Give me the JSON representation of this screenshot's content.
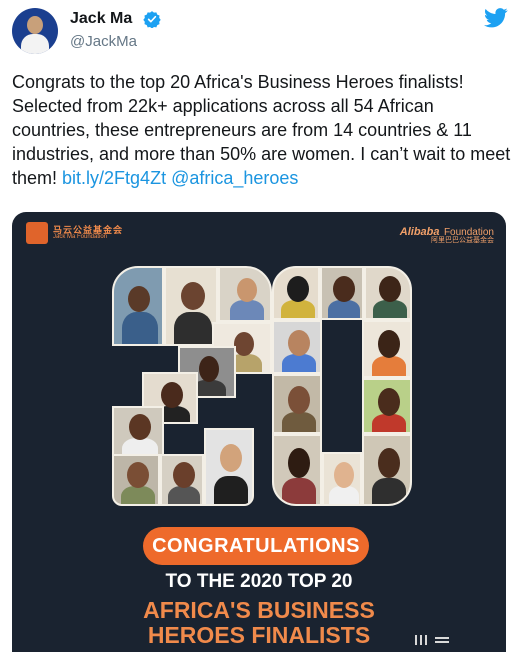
{
  "user": {
    "name": "Jack Ma",
    "handle": "@JackMa"
  },
  "tweet": {
    "text_before_links": "Congrats to the top 20 Africa's Business Heroes finalists! Selected from 22k+ applications across all 54 African countries, these entrepreneurs are from 14 countries & 11 industries, and more than 50% are women. I can’t wait to meet them! ",
    "link": "bit.ly/2Ftg4Zt",
    "mention": "@africa_heroes"
  },
  "poster": {
    "logo_left_cn": "马云公益基金会",
    "logo_left_en": "Jack Ma Foundation",
    "logo_right_brand": "Alibaba",
    "logo_right_word": "Foundation",
    "logo_right_cn": "阿里巴巴公益基金会",
    "badge": "CONGRATULATIONS",
    "line1": "TO THE 2020 TOP 20",
    "line2": "AFRICA'S BUSINESS",
    "line3": "HEROES FINALISTS"
  },
  "colors": {
    "link": "#1b95e0",
    "poster_bg": "#1a2330",
    "accent": "#ee6a2b",
    "twitter": "#1da1f2"
  }
}
